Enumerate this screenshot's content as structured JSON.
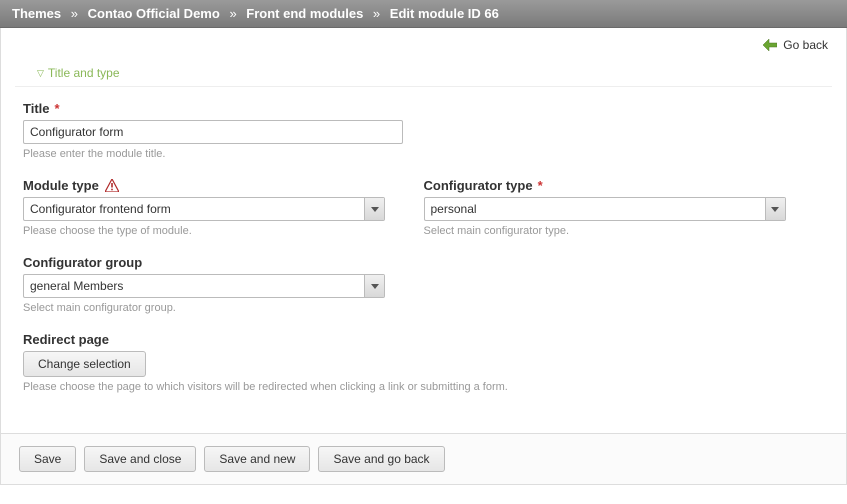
{
  "breadcrumb": {
    "items": [
      "Themes",
      "Contao Official Demo",
      "Front end modules",
      "Edit module ID 66"
    ]
  },
  "topbar": {
    "go_back": "Go back"
  },
  "section": {
    "title": "Title and type"
  },
  "fields": {
    "title": {
      "label": "Title",
      "value": "Configurator form",
      "help": "Please enter the module title."
    },
    "module_type": {
      "label": "Module type",
      "value": "Configurator frontend form",
      "help": "Please choose the type of module."
    },
    "configurator_type": {
      "label": "Configurator type",
      "value": "personal",
      "help": "Select main configurator type."
    },
    "configurator_group": {
      "label": "Configurator group",
      "value": "general Members",
      "help": "Select main configurator group."
    },
    "redirect": {
      "label": "Redirect page",
      "button": "Change selection",
      "help": "Please choose the page to which visitors will be redirected when clicking a link or submitting a form."
    }
  },
  "buttons": {
    "save": "Save",
    "save_close": "Save and close",
    "save_new": "Save and new",
    "save_back": "Save and go back"
  }
}
